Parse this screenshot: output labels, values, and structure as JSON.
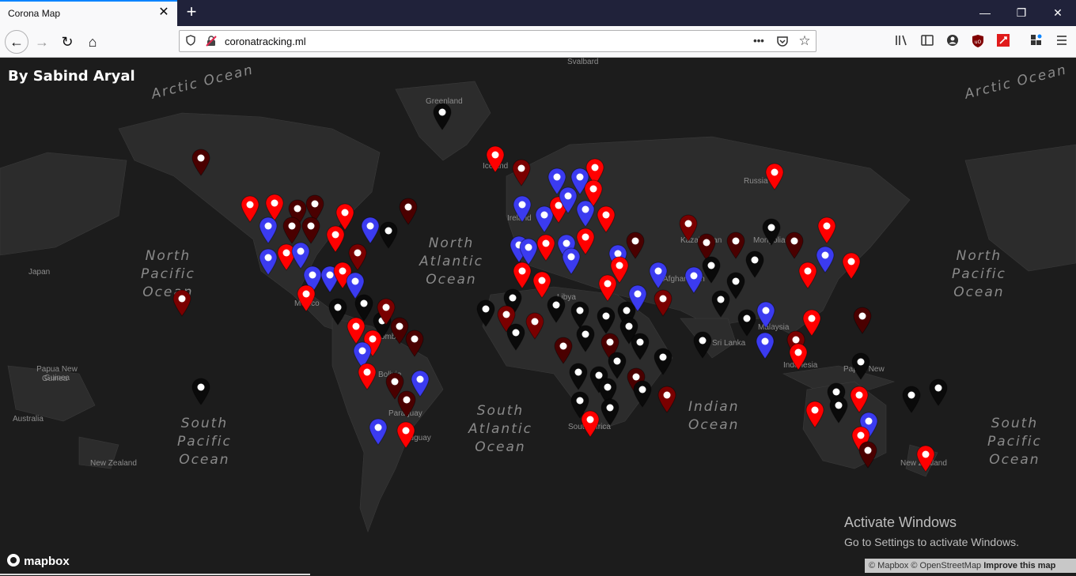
{
  "browser": {
    "tab_title": "Corona Map",
    "tab_close": "✕",
    "new_tab": "+",
    "url": "coronatracking.ml",
    "window_controls": [
      "—",
      "❐",
      "✕"
    ],
    "nav": {
      "back": "←",
      "forward": "→",
      "reload": "↻",
      "home": "⌂"
    },
    "url_icons": {
      "shield": "shield-icon",
      "insecure": "insecure-lock-icon",
      "more": "•••",
      "pocket": "pocket-icon",
      "star": "☆"
    },
    "toolbar_icons": [
      "library-icon",
      "sidebar-icon",
      "account-icon",
      "ublock-icon",
      "extension-icon",
      "apps-icon",
      "menu-icon"
    ]
  },
  "map": {
    "author": "By Sabind Aryal",
    "oceans": [
      {
        "name": "Arctic Ocean"
      },
      {
        "name": "Arctic Ocean"
      },
      {
        "name": "North\nPacific\nOcean"
      },
      {
        "name": "North\nAtlantic\nOcean"
      },
      {
        "name": "North\nPacific\nOcean"
      },
      {
        "name": "South\nPacific\nOcean"
      },
      {
        "name": "South\nAtlantic\nOcean"
      },
      {
        "name": "Indian\nOcean"
      },
      {
        "name": "South\nPacific\nOcean"
      }
    ],
    "places": [
      "Greenland",
      "Svalbard",
      "Iceland",
      "Russia",
      "Japan",
      "Mexico",
      "Libya",
      "Mongolia",
      "Kazakhstan",
      "Afghanistan",
      "Sri Lanka",
      "Malaysia",
      "Indonesia",
      "Papua New Guinea",
      "Papua New",
      "Australia",
      "New Zealand",
      "New Zealand",
      "Paraguay",
      "Uruguay",
      "Ireland",
      "South Africa",
      "Colombia",
      "Bolivia",
      "Guinea"
    ],
    "pin_colors": {
      "red": "#ff0000",
      "blue": "#3b3bf0",
      "maroon": "#7a0000",
      "darkred": "#4a0000",
      "black": "#0a0a0a"
    },
    "attribution": {
      "mapbox": "© Mapbox",
      "osm": "© OpenStreetMap",
      "improve": "Improve this map"
    },
    "logo": "mapbox",
    "activate": {
      "title": "Activate Windows",
      "subtitle": "Go to Settings to activate Windows."
    }
  }
}
